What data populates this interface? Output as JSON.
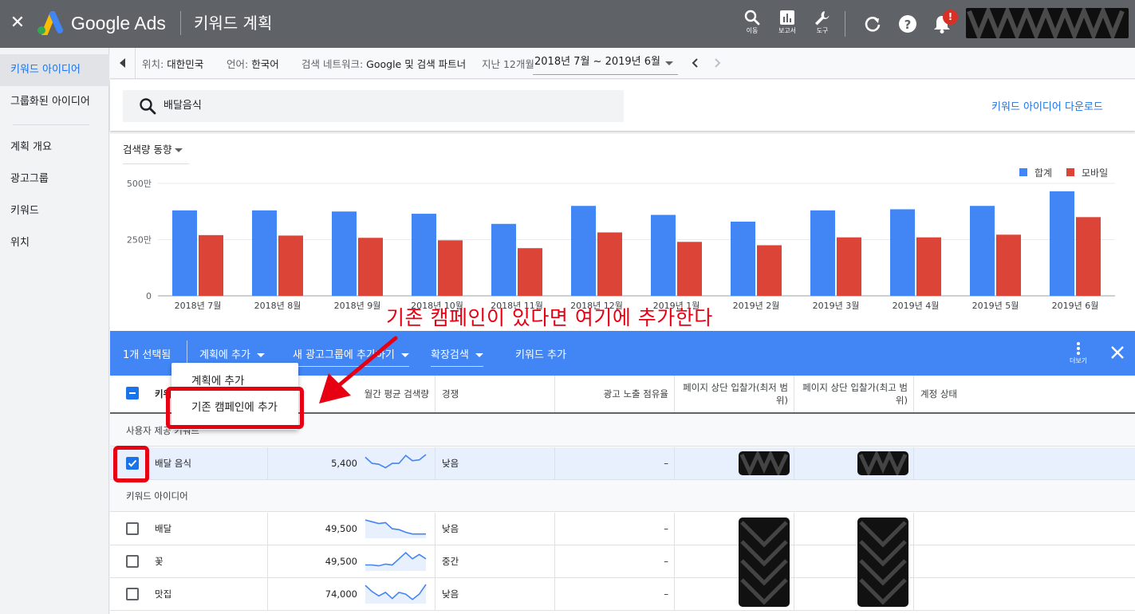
{
  "topbar": {
    "brand": "Google Ads",
    "page_title": "키워드 계획",
    "tools": {
      "go": "이동",
      "reports": "보고서",
      "tools": "도구"
    },
    "notification_count": "!",
    "colors": {
      "bar": "#5f6368",
      "logo_blue": "#4285f4",
      "logo_yellow": "#fbbc04",
      "logo_green": "#34a853"
    }
  },
  "sidebar": {
    "items": [
      {
        "label": "키워드 아이디어",
        "active": true
      },
      {
        "label": "그룹화된 아이디어"
      },
      {
        "label": "계획 개요"
      },
      {
        "label": "광고그룹"
      },
      {
        "label": "키워드"
      },
      {
        "label": "위치"
      }
    ]
  },
  "filters": {
    "location_key": "위치:",
    "location_val": "대한민국",
    "language_key": "언어:",
    "language_val": "한국어",
    "network_key": "검색 네트워크:",
    "network_val": "Google 및 검색 파트너",
    "period_key": "지난 12개월",
    "date_range": "2018년 7월 ~ 2019년 6월"
  },
  "search": {
    "query": "배달음식",
    "download_label": "키워드 아이디어 다운로드"
  },
  "chart_data": {
    "type": "bar",
    "metric_label": "검색량 동향",
    "categories": [
      "2018년 7월",
      "2018년 8월",
      "2018년 9월",
      "2018년 10월",
      "2018년 11월",
      "2018년 12월",
      "2019년 1월",
      "2019년 2월",
      "2019년 3월",
      "2019년 4월",
      "2019년 5월",
      "2019년 6월"
    ],
    "series": [
      {
        "name": "합계",
        "color": "#4285f4",
        "values": [
          3.8,
          3.8,
          3.75,
          3.65,
          3.2,
          4.0,
          3.6,
          3.3,
          3.8,
          3.85,
          4.0,
          4.65
        ]
      },
      {
        "name": "모바일",
        "color": "#db4437",
        "values": [
          2.7,
          2.68,
          2.58,
          2.47,
          2.12,
          2.82,
          2.4,
          2.25,
          2.6,
          2.6,
          2.72,
          3.5
        ]
      }
    ],
    "unit": "백만",
    "y_ticks": [
      "0",
      "250만",
      "500만"
    ],
    "ylim": [
      0,
      5
    ],
    "legend": "top-right",
    "grid": true
  },
  "actionbar": {
    "selected": "1개 선택됨",
    "add_to_plan": "계획에 추가",
    "new_adgroup": "새 광고그룹에 추가하기",
    "broaden": "확장검색",
    "add_keyword": "키워드 추가",
    "more": "더보기",
    "color": "#4285f4"
  },
  "dropdown": {
    "items": [
      "계획에 추가",
      "기존 캠페인에 추가"
    ]
  },
  "table": {
    "headers": {
      "keyword": "키워드",
      "avg_searches": "월간 평균 검색량",
      "competition": "경쟁",
      "impression_share": "광고 노출 점유율",
      "top_bid_low": "페이지 상단 입찰가(최저 범위)",
      "top_bid_high": "페이지 상단 입찰가(최고 범위)",
      "account_status": "계정 상태"
    },
    "group_provided": "사용자 제공 키워드",
    "group_ideas": "키워드 아이디어",
    "provided_rows": [
      {
        "keyword": "배달 음식",
        "searches": "5,400",
        "trend": [
          0.2,
          0.55,
          0.6,
          0.8,
          0.55,
          0.55,
          0.1,
          0.4,
          0.35,
          0.05
        ],
        "competition": "낮음",
        "share": "–"
      }
    ],
    "idea_rows": [
      {
        "keyword": "배달",
        "searches": "49,500",
        "trend": [
          0.05,
          0.15,
          0.25,
          0.2,
          0.55,
          0.6,
          0.75,
          0.85,
          0.85,
          0.85
        ],
        "competition": "낮음",
        "share": "–"
      },
      {
        "keyword": "꽃",
        "searches": "49,500",
        "trend": [
          0.75,
          0.75,
          0.8,
          0.7,
          0.75,
          0.4,
          0.05,
          0.4,
          0.15,
          0.4
        ],
        "competition": "중간",
        "share": "–"
      },
      {
        "keyword": "맛집",
        "searches": "74,000",
        "trend": [
          0.05,
          0.4,
          0.65,
          0.45,
          0.8,
          0.45,
          0.55,
          0.85,
          0.55,
          0.0
        ],
        "competition": "낮음",
        "share": "–"
      }
    ]
  },
  "annotation": {
    "text": "기존 캠페인이 있다면 여기에 추가한다",
    "color": "#e60012"
  }
}
